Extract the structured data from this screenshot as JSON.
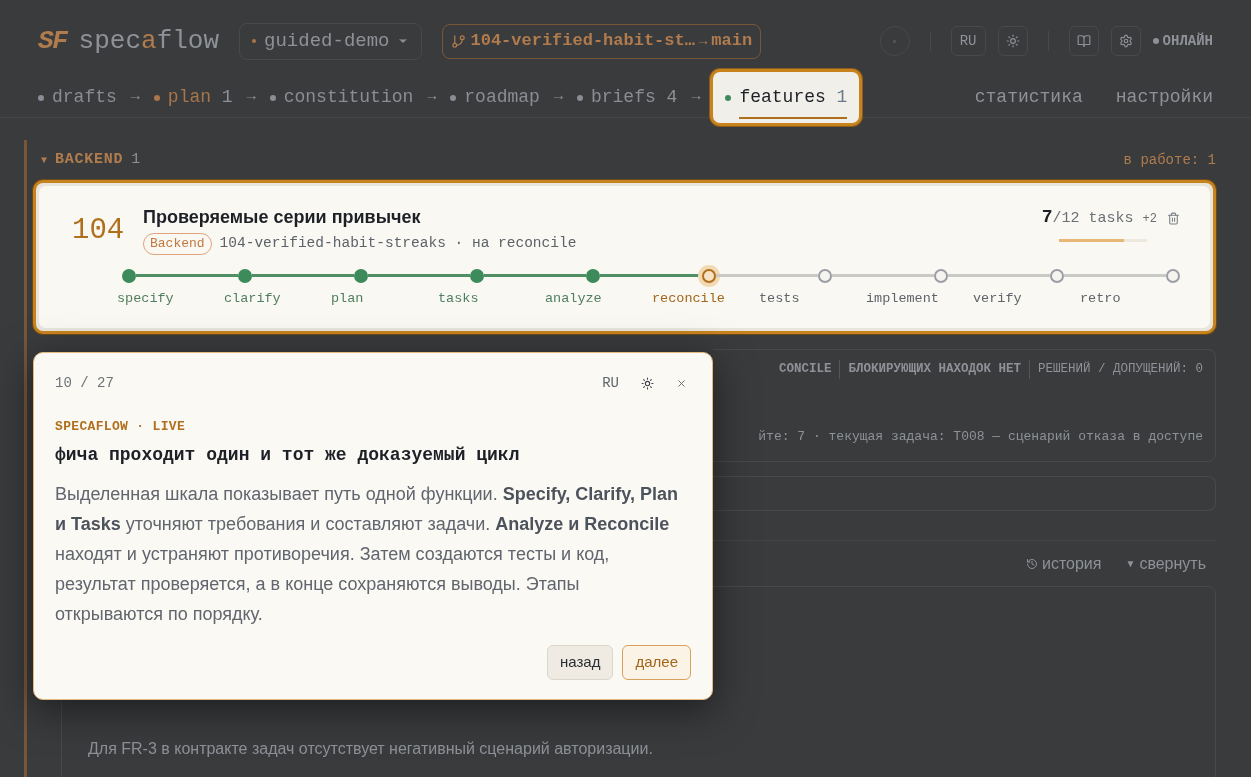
{
  "header": {
    "logo_mark": "SF",
    "logo": [
      "spec",
      "a",
      "flow"
    ],
    "project": "guided-demo",
    "branch": {
      "from": "104-verified-habit-st…",
      "arrow": "→",
      "to": "main"
    },
    "lang": "RU",
    "status": "ОНЛАЙН"
  },
  "nav": [
    {
      "label": "drafts",
      "color": "#8a8d93",
      "selected": false
    },
    {
      "arrow": "→",
      "label": "plan",
      "count": "1",
      "color": "#a8764a",
      "selected": false
    },
    {
      "arrow": "→",
      "label": "constitution",
      "color": "#8a8d93",
      "selected": false
    },
    {
      "arrow": "→",
      "label": "roadmap",
      "color": "#8a8d93",
      "selected": false
    },
    {
      "arrow": "→",
      "label": "briefs",
      "count": "4",
      "color": "#8a8d93",
      "selected": false
    },
    {
      "arrow": "→",
      "label": "features",
      "count": "1",
      "color": "#3d8b5a",
      "selected": true
    }
  ],
  "nav_right": [
    "статистика",
    "настройки"
  ],
  "group": {
    "caret": "▼",
    "title": "BACKEND",
    "count": "1",
    "expanded": true,
    "in_progress": "в работе: 1"
  },
  "feature": {
    "number": "104",
    "title": "Проверяемые серии привычек",
    "tag": "Backend",
    "slug": "104-verified-habit-streaks · на reconcile",
    "done": "7",
    "total": "/12 tasks",
    "extra": "+2",
    "level": 0.74,
    "stages": [
      {
        "label": "specify",
        "kind": "done"
      },
      {
        "label": "clarify",
        "kind": "done"
      },
      {
        "label": "plan",
        "kind": "done"
      },
      {
        "label": "tasks",
        "kind": "done"
      },
      {
        "label": "analyze",
        "kind": "done"
      },
      {
        "label": "reconcile",
        "kind": "current"
      },
      {
        "label": "tests",
        "kind": "pending"
      },
      {
        "label": "implement",
        "kind": "pending"
      },
      {
        "label": "verify",
        "kind": "pending"
      },
      {
        "label": "retro",
        "kind": "pending"
      }
    ]
  },
  "details": {
    "badges": [
      "CONCILE",
      "БЛОКИРУЮЩИХ НАХОДОК НЕТ",
      "РЕШЕНИЙ / ДОПУЩЕНИЙ: 0"
    ],
    "progress_line": "йте: 7 · текущая задача: T008 — сценарий отказа в доступе"
  },
  "panel": {
    "history": "история",
    "collapse_caret": "▼",
    "collapse": "свернуть",
    "finding": "Для FR-3 в контракте задач отсутствует негативный сценарий авторизации."
  },
  "tour": {
    "step": "10 / 27",
    "lang": "RU",
    "eyebrow": "SPECAFLOW · LIVE",
    "title": "фича проходит один и тот же доказуемый цикл",
    "body": "Выделенная шкала показывает путь одной функции. **Specify, Clarify, Plan и Tasks** уточняют требования и составляют задачи. **Analyze и Reconcile** находят и устраняют противоречия. Затем создаются тесты и код, результат проверяется, а в конце сохраняются выводы. Этапы открываются по порядку.",
    "back": "назад",
    "next": "далее"
  }
}
